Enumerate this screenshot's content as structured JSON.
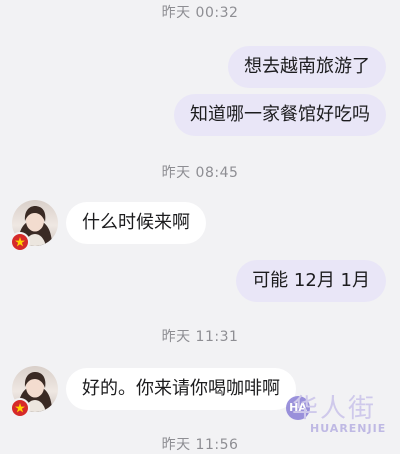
{
  "messages": [
    {
      "type": "timestamp",
      "text": "昨天 00:32"
    },
    {
      "type": "outgoing",
      "text": "想去越南旅游了"
    },
    {
      "type": "outgoing",
      "text": "知道哪一家餐馆好吃吗"
    },
    {
      "type": "timestamp",
      "text": "昨天 08:45"
    },
    {
      "type": "incoming",
      "text": "什么时候来啊"
    },
    {
      "type": "outgoing",
      "text": "可能 12月 1月"
    },
    {
      "type": "timestamp",
      "text": "昨天 11:31"
    },
    {
      "type": "incoming",
      "text": "好的。你来请你喝咖啡啊"
    },
    {
      "type": "timestamp",
      "text": "昨天 11:56"
    }
  ],
  "watermark": {
    "chinese": "华人街",
    "english": "HUARENJIE"
  },
  "colors": {
    "background": "#f2f2f4",
    "outgoing_bubble": "#e9e6f7",
    "incoming_bubble": "#ffffff",
    "timestamp_text": "#8e8e93",
    "flag": "#d62a2a"
  },
  "icons": {
    "avatar": "contact-avatar",
    "flag": "vietnam-flag-icon"
  }
}
